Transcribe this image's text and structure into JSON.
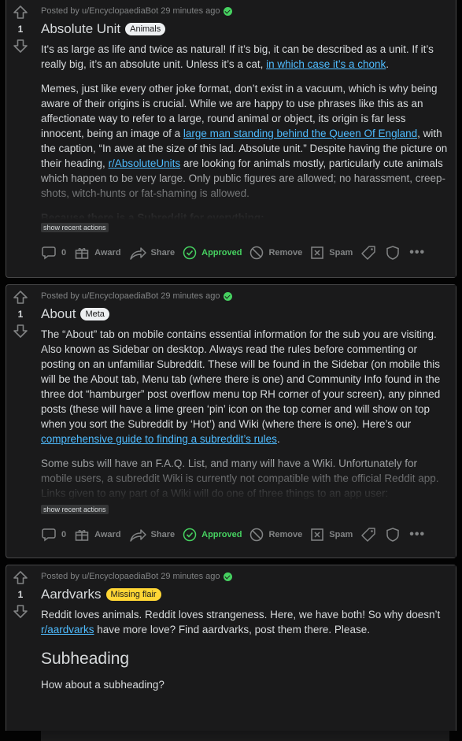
{
  "posts": [
    {
      "meta": "Posted by u/EncyclopaediaBot 29 minutes ago",
      "votes": "1",
      "title": "Absolute Unit",
      "flair": "Animals",
      "p1_a": "It's as large as life and twice as natural! If it’s big, it can be described as a unit. If it’s really big, it’s an absolute unit. Unless it’s a cat, ",
      "p1_link": "in which case it’s a chonk",
      "p1_b": ".",
      "p2_a": "Memes, just like every other joke format, don’t exist in a vacuum, which is why being aware of their origins is crucial. While we are happy to use phrases like this as an affectionate way to refer to a large, round animal or object, its origin is far less innocent, being an image of a ",
      "p2_link": "large man standing behind the Queen Of England",
      "p2_b": ", with the caption, “In awe at the size of this lad. Absolute unit.” Despite having the picture on their heading, ",
      "p2_link2": "r/AbsoluteUnits",
      "p2_c": " are looking for animals mostly, particularly cute animals which happen to be very large. Only public figures are allowed; no harassment, creep-shots, witch-hunts or fat-shaming is allowed.",
      "p3": "Because there is a Subreddit for everything:",
      "recent": "show recent actions",
      "comments": "0",
      "award": "Award",
      "share": "Share",
      "approved": "Approved",
      "remove": "Remove",
      "spam": "Spam"
    },
    {
      "meta": "Posted by u/EncyclopaediaBot 29 minutes ago",
      "votes": "1",
      "title": "About",
      "flair": "Meta",
      "p1_a": "The “About” tab on mobile contains essential information for the sub you are visiting. Also known as Sidebar on desktop. Always read the rules before commenting or posting on an unfamiliar Subreddit. These will be found in the Sidebar (on mobile this will be the About tab, Menu tab (where there is one) and Community Info found in the three dot “hamburger” post overflow menu top RH corner of your screen), any pinned posts (these will have a lime green ‘pin’ icon on the top corner and will show on top when you sort the Subreddit by ‘Hot’) and Wiki (where there is one). Here’s our ",
      "p1_link": "comprehensive guide to finding a subreddit’s rules",
      "p1_b": ".",
      "p2": "Some subs will have an F.A.Q. List, and many will have a Wiki. Unfortunately for mobile users, a subreddit Wiki is currently not compatible with the official Reddit app. Links given to any part of a Wiki will do one of three things to an app user:",
      "recent": "show recent actions",
      "comments": "0",
      "award": "Award",
      "share": "Share",
      "approved": "Approved",
      "remove": "Remove",
      "spam": "Spam"
    },
    {
      "meta": "Posted by u/EncyclopaediaBot 29 minutes ago",
      "votes": "1",
      "title": "Aardvarks",
      "flair": "Missing flair",
      "p1_a": "Reddit loves animals. Reddit loves strangeness. Here, we have both! So why doesn’t ",
      "p1_link": "r/aardvarks",
      "p1_b": " have more love? Find aardvarks, post them there. Please.",
      "subheading": "Subheading",
      "p2": "How about a subheading?"
    }
  ]
}
